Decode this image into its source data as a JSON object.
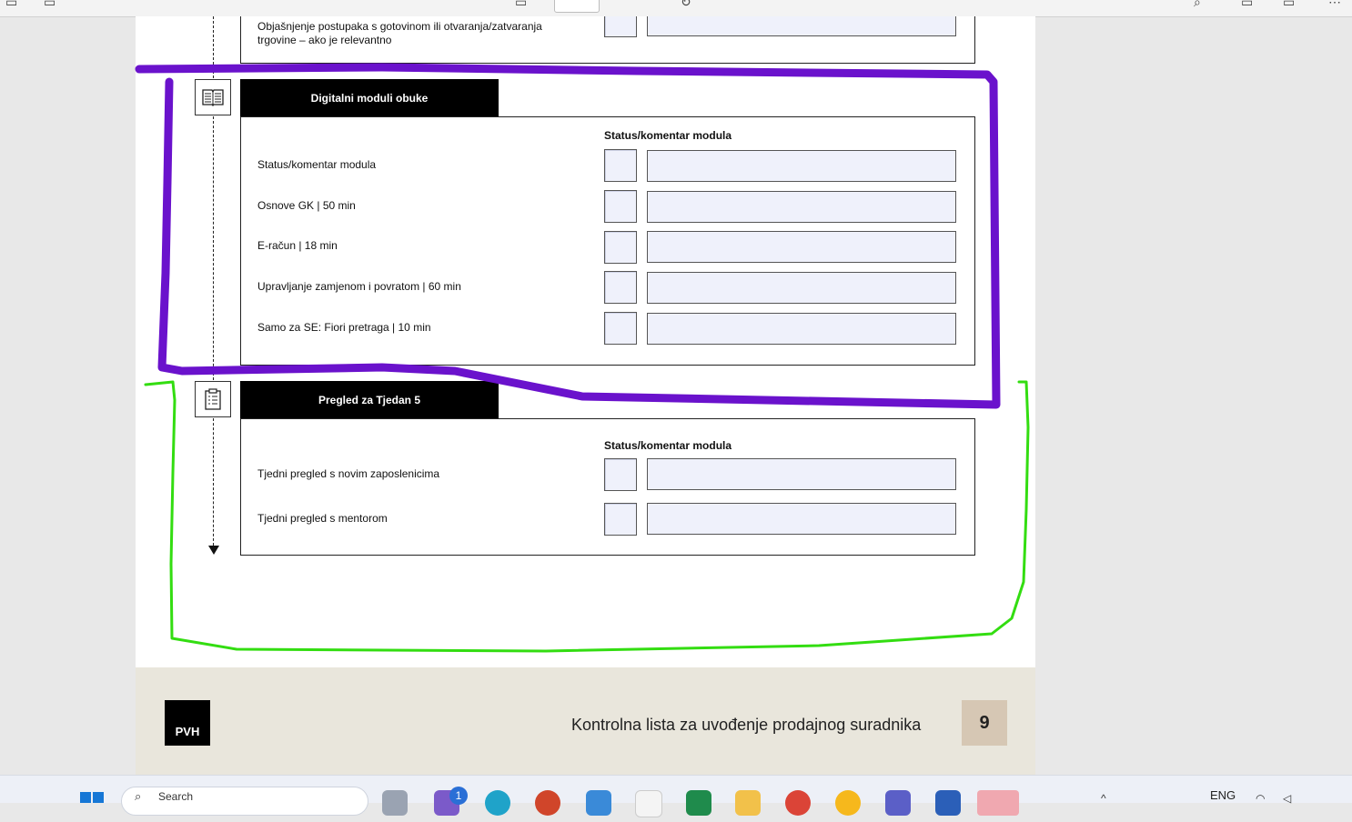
{
  "document": {
    "prev_section": {
      "row_label": "Objašnjenje postupaka s gotovinom ili otvaranja/zatvaranja trgovine – ako je relevantno"
    },
    "section_digital": {
      "title": "Digitalni moduli obuke",
      "icon": "book-icon",
      "column_header": "Status/komentar modula",
      "rows": [
        {
          "label": "Status/komentar modula"
        },
        {
          "label": "Osnove GK | 50 min"
        },
        {
          "label": "E-račun | 18 min"
        },
        {
          "label": "Upravljanje zamjenom i povratom | 60 min"
        },
        {
          "label": "Samo za SE: Fiori pretraga | 10 min"
        }
      ]
    },
    "section_week5": {
      "title": "Pregled za Tjedan 5",
      "icon": "clipboard-icon",
      "column_header": "Status/komentar modula",
      "rows": [
        {
          "label": "Tjedni pregled s novim zaposlenicima"
        },
        {
          "label": "Tjedni pregled s mentorom"
        }
      ]
    },
    "footer": {
      "logo_text": "PVH",
      "title": "Kontrolna lista za uvođenje prodajnog suradnika",
      "page_number": "9"
    }
  },
  "annotations": {
    "purple_color": "#6a12cc",
    "green_color": "#33dd11"
  },
  "taskbar": {
    "search_placeholder": "Search",
    "language": "ENG",
    "notification_badge": "1",
    "apps": [
      "windows-start-icon",
      "mail-icon",
      "edge-icon",
      "powerpoint-icon",
      "copilot-icon",
      "calendar-icon",
      "excel-icon",
      "file-explorer-icon",
      "chrome-icon",
      "weather-icon",
      "teams-icon",
      "word-icon",
      "outlook-icon"
    ]
  }
}
